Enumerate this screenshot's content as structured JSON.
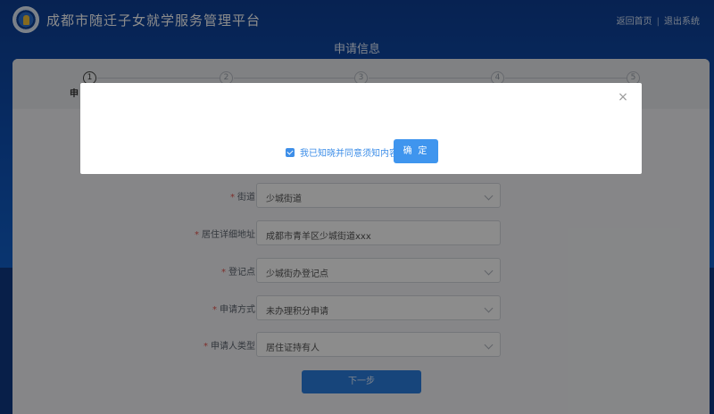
{
  "header": {
    "site_title": "成都市随迁子女就学服务管理平台",
    "links": [
      "返回首页",
      "退出系统"
    ]
  },
  "page_title": "申请信息",
  "steps": {
    "numbers": [
      "1",
      "2",
      "3",
      "4",
      "5"
    ],
    "first_label": "申"
  },
  "form": {
    "rows": [
      {
        "label": "街道",
        "value": "少城街道",
        "type": "select"
      },
      {
        "label": "居住详细地址",
        "value": "成都市青羊区少城街道xxx",
        "type": "input"
      },
      {
        "label": "登记点",
        "value": "少城街办登记点",
        "type": "select"
      },
      {
        "label": "申请方式",
        "value": "未办理积分申请",
        "type": "select"
      },
      {
        "label": "申请人类型",
        "value": "居住证持有人",
        "type": "select"
      }
    ],
    "next_label": "下一步"
  },
  "modal": {
    "close_glyph": "×",
    "agree_text": "我已知晓并同意须知内容",
    "agree_checked": true,
    "confirm_label": "确 定"
  },
  "colors": {
    "header_blue": "#0e52b8",
    "accent": "#3f95ee",
    "required": "#e5554f"
  }
}
